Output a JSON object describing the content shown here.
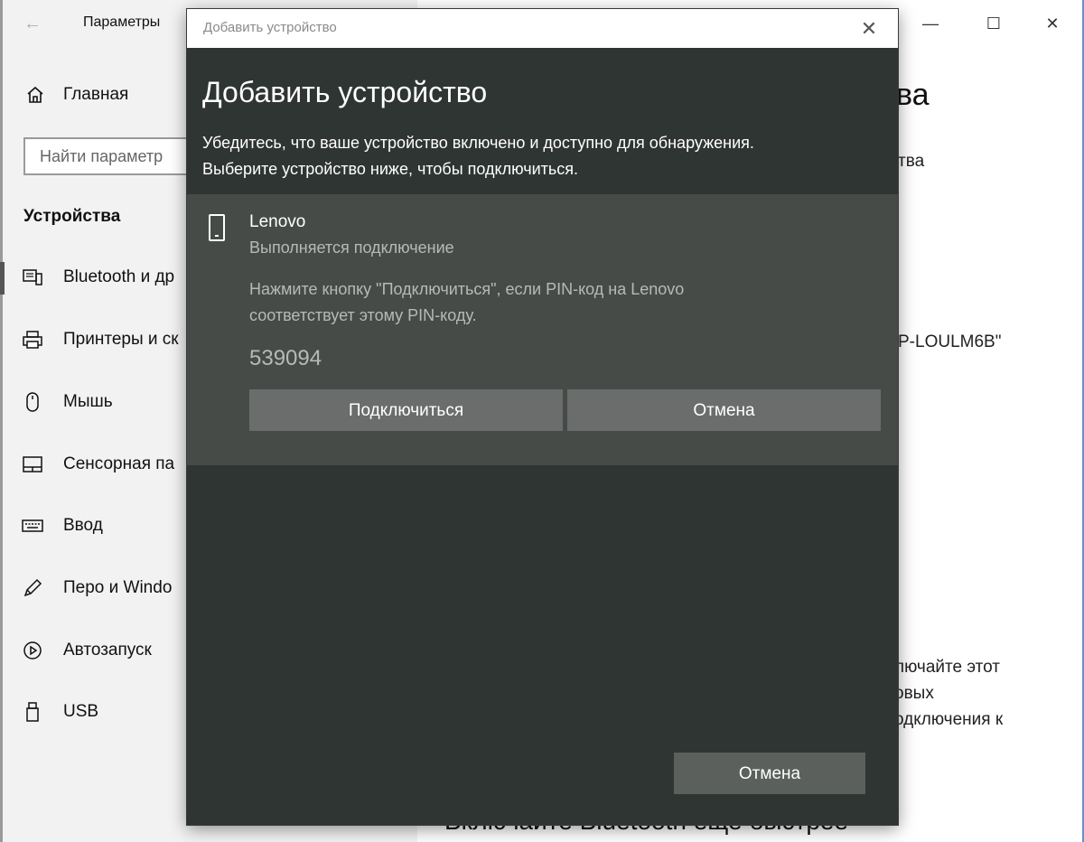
{
  "settings_window": {
    "title": "Параметры",
    "home_label": "Главная",
    "search_placeholder": "Найти параметр",
    "section_title": "Устройства",
    "nav_items": [
      {
        "label": "Bluetooth и др",
        "icon": "bluetooth-devices-icon"
      },
      {
        "label": "Принтеры и ск",
        "icon": "printer-icon"
      },
      {
        "label": "Мышь",
        "icon": "mouse-icon"
      },
      {
        "label": "Сенсорная па",
        "icon": "touchpad-icon"
      },
      {
        "label": "Ввод",
        "icon": "keyboard-icon"
      },
      {
        "label": "Перо и Windo",
        "icon": "pen-icon"
      },
      {
        "label": "Автозапуск",
        "icon": "autoplay-icon"
      },
      {
        "label": "USB",
        "icon": "usb-icon"
      }
    ],
    "right_heading_fragment": "ва",
    "right_fragments": {
      "line1": "тва",
      "line2": "P-LOULM6B\"",
      "para_line1": "лючайте этот",
      "para_line2": "овых",
      "para_line3": "одключения к"
    },
    "bottom_heading": "Включайте Bluetooth еще быстрее"
  },
  "dialog": {
    "window_title": "Добавить устройство",
    "heading": "Добавить устройство",
    "description_line1": "Убедитесь, что ваше устройство включено и доступно для обнаружения.",
    "description_line2": "Выберите устройство ниже, чтобы подключиться.",
    "device": {
      "name": "Lenovo",
      "status": "Выполняется подключение",
      "pin_hint_line1": "Нажмите кнопку \"Подключиться\", если PIN-код на Lenovo",
      "pin_hint_line2": "соответствует этому PIN-коду.",
      "pin": "539094",
      "connect_label": "Подключиться",
      "cancel_label": "Отмена"
    },
    "cancel_label": "Отмена"
  }
}
